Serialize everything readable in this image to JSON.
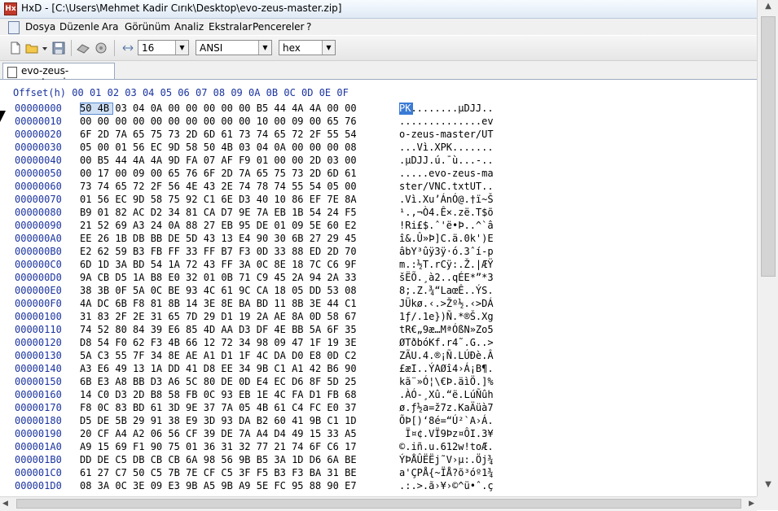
{
  "window": {
    "title": "HxD - [C:\\Users\\Mehmet Kadir Cırık\\Desktop\\evo-zeus-master.zip]",
    "app_icon": "hxd-icon",
    "close_glyph": "○"
  },
  "menu": {
    "items": [
      "Dosya",
      "Düzenle",
      "Ara",
      "Görünüm",
      "Analiz",
      "Ekstralar",
      "Pencereler",
      "?"
    ]
  },
  "toolbar": {
    "bytes_per_row": "16",
    "charset": "ANSI",
    "offset_base": "hex"
  },
  "tab": {
    "label": "evo-zeus-master.zip"
  },
  "hex_view": {
    "header_offset": "Offset(h)",
    "header_columns": "00 01 02 03 04 05 06 07 08 09 0A 0B 0C 0D 0E 0F",
    "rows": [
      {
        "offset": "00000000",
        "hex": "50 4B 03 04 0A 00 00 00 00 00 B5 44 4A 4A 00 00",
        "ascii": "PK........µDJJ.."
      },
      {
        "offset": "00000010",
        "hex": "00 00 00 00 00 00 00 00 00 00 10 00 09 00 65 76",
        "ascii": "..............ev"
      },
      {
        "offset": "00000020",
        "hex": "6F 2D 7A 65 75 73 2D 6D 61 73 74 65 72 2F 55 54",
        "ascii": "o-zeus-master/UT"
      },
      {
        "offset": "00000030",
        "hex": "05 00 01 56 EC 9D 58 50 4B 03 04 0A 00 00 00 08",
        "ascii": "...Vì.XPK......."
      },
      {
        "offset": "00000040",
        "hex": "00 B5 44 4A 4A 9D FA 07 AF F9 01 00 00 2D 03 00",
        "ascii": ".µDJJ.ú.¯ù...-.."
      },
      {
        "offset": "00000050",
        "hex": "00 17 00 09 00 65 76 6F 2D 7A 65 75 73 2D 6D 61",
        "ascii": ".....evo-zeus-ma"
      },
      {
        "offset": "00000060",
        "hex": "73 74 65 72 2F 56 4E 43 2E 74 78 74 55 54 05 00",
        "ascii": "ster/VNC.txtUT.."
      },
      {
        "offset": "00000070",
        "hex": "01 56 EC 9D 58 75 92 C1 6E D3 40 10 86 EF 7E 8A",
        "ascii": ".Vì.Xu’ÁnÓ@.†ï~Š"
      },
      {
        "offset": "00000080",
        "hex": "B9 01 82 AC D2 34 81 CA D7 9E 7A EB 1B 54 24 F5",
        "ascii": "¹.‚¬Ò4.Ê×.zë.T$õ"
      },
      {
        "offset": "00000090",
        "hex": "21 52 69 A3 24 0A 88 27 EB 95 DE 01 09 5E 60 E2",
        "ascii": "!Ri£$.ˆ'ë•Þ..^`â"
      },
      {
        "offset": "000000A0",
        "hex": "EE 26 1B DB BB DE 5D 43 13 E4 90 30 6B 27 29 45",
        "ascii": "î&.Û»Þ]C.ä.0k')E"
      },
      {
        "offset": "000000B0",
        "hex": "E2 62 59 B3 FB FF 33 FF B7 F3 0D 33 88 ED 2D 70",
        "ascii": "âbY³ûÿ3ÿ·ó.3ˆí-p"
      },
      {
        "offset": "000000C0",
        "hex": "6D 1D 3A BD 54 1A 72 43 FF 3A 0C 8E 18 7C C6 9F",
        "ascii": "m.:½T.rCÿ:.Ž.|ÆŸ"
      },
      {
        "offset": "000000D0",
        "hex": "9A CB D5 1A B8 E0 32 01 0B 71 C9 45 2A 94 2A 33",
        "ascii": "šËÕ.¸à2..qÉE*”*3"
      },
      {
        "offset": "000000E0",
        "hex": "38 3B 0F 5A 0C BE 93 4C 61 9C CA 18 05 DD 53 08",
        "ascii": "8;.Z.¾“LaœÊ..ÝS."
      },
      {
        "offset": "000000F0",
        "hex": "4A DC 6B F8 81 8B 14 3E 8E BA BD 11 8B 3E 44 C1",
        "ascii": "JÜkø.‹.>Žº½.‹>DÁ"
      },
      {
        "offset": "00000100",
        "hex": "31 83 2F 2E 31 65 7D 29 D1 19 2A AE 8A 0D 58 67",
        "ascii": "1ƒ/.1e})Ñ.*®Š.Xg"
      },
      {
        "offset": "00000110",
        "hex": "74 52 80 84 39 E6 85 4D AA D3 DF 4E BB 5A 6F 35",
        "ascii": "tR€„9æ…MªÓßN»Zo5"
      },
      {
        "offset": "00000120",
        "hex": "D8 54 F0 62 F3 4B 66 12 72 34 98 09 47 1F 19 3E",
        "ascii": "ØTðbóKf.r4˜.G..>"
      },
      {
        "offset": "00000130",
        "hex": "5A C3 55 7F 34 8E AE A1 D1 1F 4C DA D0 E8 0D C2",
        "ascii": "ZÃU.4.®¡Ñ.LÚÐè.Â"
      },
      {
        "offset": "00000140",
        "hex": "A3 E6 49 13 1A DD 41 D8 EE 34 9B C1 A1 42 B6 90",
        "ascii": "£æI..ÝAØî4›Á¡B¶."
      },
      {
        "offset": "00000150",
        "hex": "6B E3 A8 BB D3 A6 5C 80 DE 0D E4 EC D6 8F 5D 25",
        "ascii": "kã¨»Ó¦\\€Þ.äìÖ.]%"
      },
      {
        "offset": "00000160",
        "hex": "14 C0 D3 2D B8 58 FB 0C 93 EB 1E 4C FA D1 FB 68",
        "ascii": ".ÀÓ-¸Xû.“ë.LúÑûh"
      },
      {
        "offset": "00000170",
        "hex": "F8 0C 83 BD 61 3D 9E 37 7A 05 4B 61 C4 FC E0 37",
        "ascii": "ø.ƒ½a=ž7z.KaÄüà7"
      },
      {
        "offset": "00000180",
        "hex": "D5 DE 5B 29 91 38 E9 3D 93 DA B2 60 41 9B C1 1D",
        "ascii": "ÕÞ[)‘8é=“Ú²`A›Á."
      },
      {
        "offset": "00000190",
        "hex": "20 CF A4 A2 06 56 CF 39 DE 7A A4 D4 49 15 33 A5",
        "ascii": " Ï¤¢.VÏ9Þz¤ÔI.3¥"
      },
      {
        "offset": "000001A0",
        "hex": "A9 15 69 F1 90 75 01 36 31 32 77 21 74 6F C6 17",
        "ascii": "©.iñ.u.612w!toÆ."
      },
      {
        "offset": "000001B0",
        "hex": "DD DE C5 DB CB CB 6A 98 56 9B B5 3A 1D D6 6A BE",
        "ascii": "ÝÞÅÛËËj˜V›µ:.Öj¾"
      },
      {
        "offset": "000001C0",
        "hex": "61 27 C7 50 C5 7B 7E CF C5 3F F5 B3 F3 BA 31 BE",
        "ascii": "a'ÇPÅ{~ÏÅ?õ³óº1¾"
      },
      {
        "offset": "000001D0",
        "hex": "08 3A 0C 3E 09 E3 9B A5 9B A9 5E FC 95 88 90 E7",
        "ascii": ".:.>.ã›¥›©^ü•ˆ.ç"
      }
    ]
  }
}
